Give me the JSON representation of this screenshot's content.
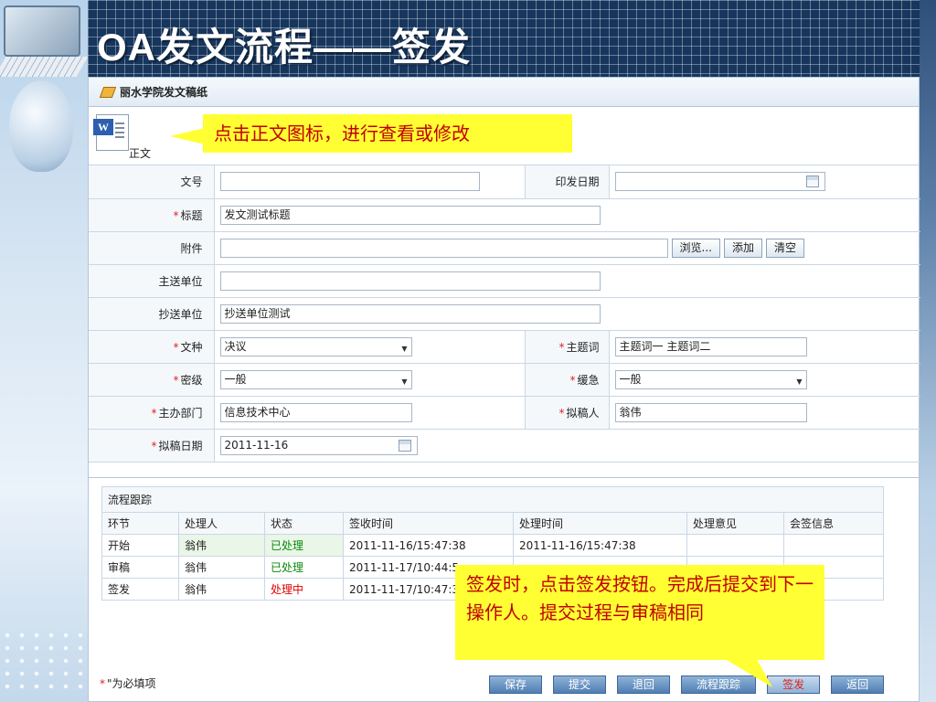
{
  "slide": {
    "title": "OA发文流程——签发"
  },
  "window": {
    "title": "丽水学院发文稿纸"
  },
  "doc": {
    "label": "正文",
    "icon": "word-document-icon"
  },
  "callouts": {
    "doc_hint": "点击正文图标，进行查看或修改",
    "sign_hint": "签发时，点击签发按钮。完成后提交到下一操作人。提交过程与审稿相同"
  },
  "form": {
    "doc_no": {
      "label": "文号",
      "value": ""
    },
    "print_date": {
      "label": "印发日期",
      "value": ""
    },
    "title": {
      "label": "标题",
      "value": "发文测试标题"
    },
    "attachment": {
      "label": "附件",
      "value": "",
      "browse": "浏览...",
      "add": "添加",
      "clear": "清空"
    },
    "main_unit": {
      "label": "主送单位",
      "value": ""
    },
    "cc_unit": {
      "label": "抄送单位",
      "value": "抄送单位测试"
    },
    "doc_type": {
      "label": "文种",
      "value": "决议"
    },
    "keywords": {
      "label": "主题词",
      "value": "主题词一 主题词二"
    },
    "secret_level": {
      "label": "密级",
      "value": "一般"
    },
    "urgency": {
      "label": "缓急",
      "value": "一般"
    },
    "host_dept": {
      "label": "主办部门",
      "value": "信息技术中心"
    },
    "drafter": {
      "label": "拟稿人",
      "value": "翁伟"
    },
    "draft_date": {
      "label": "拟稿日期",
      "value": "2011-11-16"
    },
    "required_mark": "*"
  },
  "tracking": {
    "caption": "流程跟踪",
    "headers": [
      "环节",
      "处理人",
      "状态",
      "签收时间",
      "处理时间",
      "处理意见",
      "会签信息"
    ],
    "rows": [
      {
        "step": "开始",
        "handler": "翁伟",
        "status": "已处理",
        "received": "2011-11-16/15:47:38",
        "processed": "2011-11-16/15:47:38"
      },
      {
        "step": "审稿",
        "handler": "翁伟",
        "status": "已处理",
        "received": "2011-11-17/10:44:5",
        "processed": ""
      },
      {
        "step": "签发",
        "handler": "翁伟",
        "status": "处理中",
        "received": "2011-11-17/10:47:3",
        "processed": ""
      }
    ],
    "status_colors": {
      "done": "#0a8a0a",
      "in_progress": "#e00000"
    }
  },
  "footer": {
    "required_note_mark": "*",
    "required_note": "\"为必填项",
    "buttons": {
      "save": "保存",
      "submit": "提交",
      "return": "退回",
      "track": "流程跟踪",
      "sign": "签发",
      "back": "返回"
    }
  },
  "colors": {
    "title_bg": "#17365d",
    "callout_bg": "#ffff33",
    "callout_text": "#c00000",
    "button": "#4f7fb3"
  }
}
